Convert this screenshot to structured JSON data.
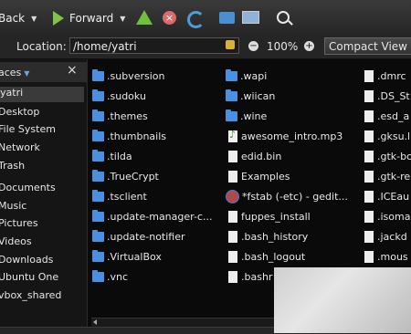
{
  "toolbar": {
    "back_label": "Back",
    "forward_label": "Forward"
  },
  "location": {
    "label": "Location:",
    "path": "/home/yatri",
    "zoom": "100%",
    "view_mode": "Compact View"
  },
  "sidebar": {
    "header": "aces",
    "items": [
      {
        "label": "yatri",
        "selected": true
      },
      {
        "label": "Desktop"
      },
      {
        "label": "File System"
      },
      {
        "label": "Network"
      },
      {
        "label": "Trash"
      },
      {
        "label": "Documents"
      },
      {
        "label": "Music"
      },
      {
        "label": "Pictures"
      },
      {
        "label": "Videos"
      },
      {
        "label": "Downloads"
      },
      {
        "label": "Ubuntu One"
      },
      {
        "label": "vbox_shared"
      }
    ]
  },
  "files": {
    "col1": [
      {
        "name": ".subversion",
        "icon": "folder-icon"
      },
      {
        "name": ".sudoku",
        "icon": "folder-icon"
      },
      {
        "name": ".themes",
        "icon": "folder-icon"
      },
      {
        "name": ".thumbnails",
        "icon": "folder-icon"
      },
      {
        "name": ".tilda",
        "icon": "folder-icon"
      },
      {
        "name": ".TrueCrypt",
        "icon": "folder-icon"
      },
      {
        "name": ".tsclient",
        "icon": "folder-icon"
      },
      {
        "name": ".update-manager-c...",
        "icon": "folder-icon"
      },
      {
        "name": ".update-notifier",
        "icon": "folder-icon"
      },
      {
        "name": ".VirtualBox",
        "icon": "folder-icon"
      },
      {
        "name": ".vnc",
        "icon": "folder-icon"
      }
    ],
    "col2": [
      {
        "name": ".wapi",
        "icon": "folder-icon"
      },
      {
        "name": ".wiican",
        "icon": "folder-icon"
      },
      {
        "name": ".wine",
        "icon": "folder-icon"
      },
      {
        "name": "awesome_intro.mp3",
        "icon": "music-file-icon"
      },
      {
        "name": "edid.bin",
        "icon": "file-icon"
      },
      {
        "name": "Examples",
        "icon": "file-icon"
      },
      {
        "name": "*fstab (-etc) - gedit...",
        "icon": "text-editor-icon"
      },
      {
        "name": "fuppes_install",
        "icon": "file-icon"
      },
      {
        "name": ".bash_history",
        "icon": "file-icon"
      },
      {
        "name": ".bash_logout",
        "icon": "file-icon"
      },
      {
        "name": ".bashr",
        "icon": "file-icon"
      }
    ],
    "col3": [
      {
        "name": ".dmrc",
        "icon": "file-icon"
      },
      {
        "name": ".DS_St",
        "icon": "file-icon"
      },
      {
        "name": ".esd_a",
        "icon": "file-icon"
      },
      {
        "name": ".gksu.l",
        "icon": "file-icon"
      },
      {
        "name": ".gtk-bo",
        "icon": "file-icon"
      },
      {
        "name": ".gtk-re",
        "icon": "file-icon"
      },
      {
        "name": ".ICEau",
        "icon": "file-icon"
      },
      {
        "name": ".isoma",
        "icon": "file-icon"
      },
      {
        "name": ".jackd",
        "icon": "file-icon"
      },
      {
        "name": ".mous",
        "icon": "file-icon"
      }
    ]
  },
  "colors": {
    "folder": "#4a8fe0",
    "background": "#0a0a0a",
    "toolbar": "#2e2e2e"
  }
}
